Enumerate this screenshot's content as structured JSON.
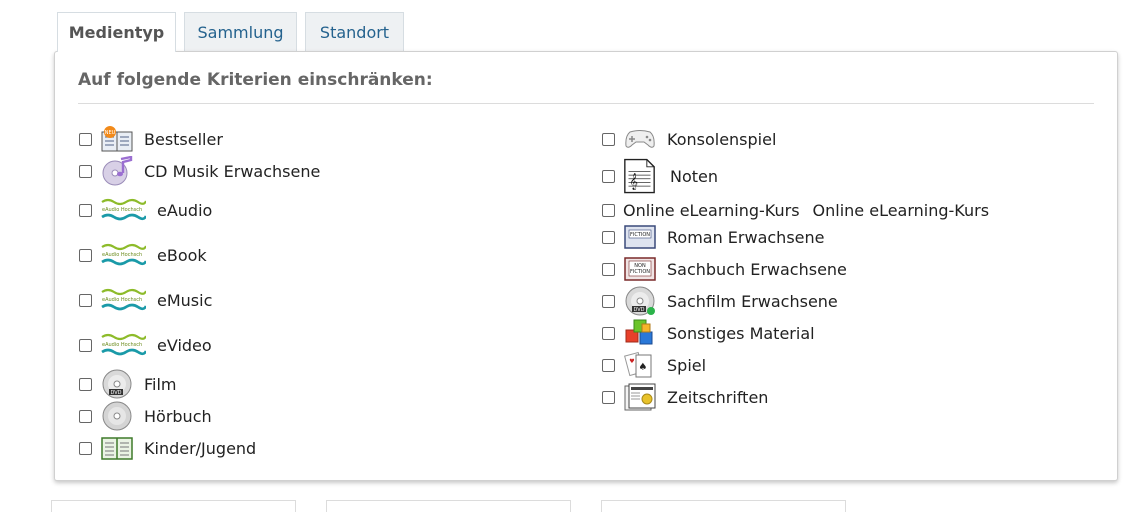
{
  "tabs": [
    {
      "label": "Medientyp",
      "active": true
    },
    {
      "label": "Sammlung",
      "active": false
    },
    {
      "label": "Standort",
      "active": false
    }
  ],
  "panel": {
    "title": "Auf folgende Kriterien einschränken:",
    "left_items": [
      {
        "label": "Bestseller",
        "icon": "bestseller-book-icon"
      },
      {
        "label": "CD Musik Erwachsene",
        "icon": "cd-music-icon"
      },
      {
        "label": "eAudio",
        "icon": "onleihe-logo-icon"
      },
      {
        "label": "eBook",
        "icon": "onleihe-logo-icon"
      },
      {
        "label": "eMusic",
        "icon": "onleihe-logo-icon"
      },
      {
        "label": "eVideo",
        "icon": "onleihe-logo-icon"
      },
      {
        "label": "Film",
        "icon": "dvd-icon"
      },
      {
        "label": "Hörbuch",
        "icon": "cd-icon"
      },
      {
        "label": "Kinder/Jugend",
        "icon": "open-book-icon"
      }
    ],
    "right_items": [
      {
        "label": "Konsolenspiel",
        "icon": "gamepad-icon"
      },
      {
        "label": "Noten",
        "icon": "sheet-music-icon"
      },
      {
        "label": "Online eLearning-Kurs",
        "label_inline": "Online eLearning-Kurs",
        "icon": "broken-image"
      },
      {
        "label": "Roman Erwachsene",
        "icon": "fiction-book-icon"
      },
      {
        "label": "Sachbuch Erwachsene",
        "icon": "nonfiction-book-icon"
      },
      {
        "label": "Sachfilm Erwachsene",
        "icon": "dvd-icon"
      },
      {
        "label": "Sonstiges Material",
        "icon": "colored-cubes-icon"
      },
      {
        "label": "Spiel",
        "icon": "playing-cards-icon"
      },
      {
        "label": "Zeitschriften",
        "icon": "magazine-icon"
      }
    ]
  },
  "colors": {
    "tab_link": "#24628e",
    "onleihe_green": "#8dbb2a",
    "onleihe_teal": "#1a9aa8"
  }
}
